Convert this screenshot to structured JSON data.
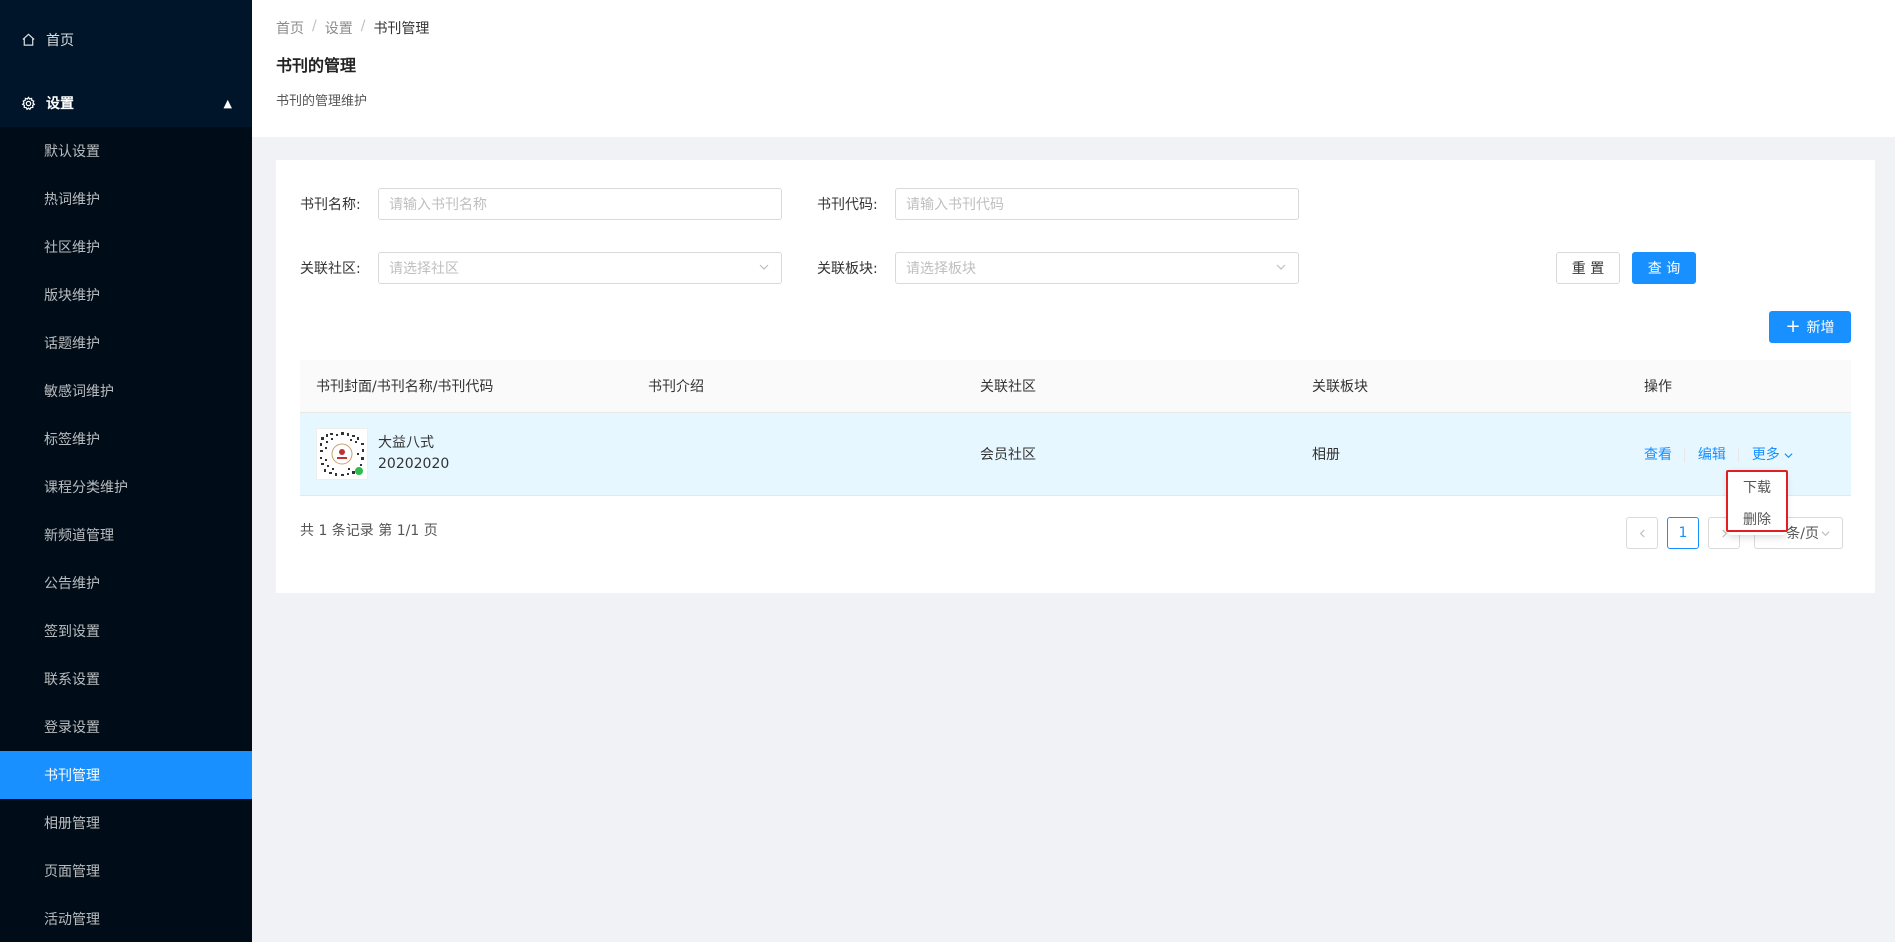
{
  "sidebar": {
    "home_label": "首页",
    "group_label": "设置",
    "items": [
      {
        "label": "默认设置"
      },
      {
        "label": "热词维护"
      },
      {
        "label": "社区维护"
      },
      {
        "label": "版块维护"
      },
      {
        "label": "话题维护"
      },
      {
        "label": "敏感词维护"
      },
      {
        "label": "标签维护"
      },
      {
        "label": "课程分类维护"
      },
      {
        "label": "新频道管理"
      },
      {
        "label": "公告维护"
      },
      {
        "label": "签到设置"
      },
      {
        "label": "联系设置"
      },
      {
        "label": "登录设置"
      },
      {
        "label": "书刊管理"
      },
      {
        "label": "相册管理"
      },
      {
        "label": "页面管理"
      },
      {
        "label": "活动管理"
      }
    ],
    "active_item": "书刊管理"
  },
  "header": {
    "breadcrumb": [
      "首页",
      "设置",
      "书刊管理"
    ],
    "title": "书刊的管理",
    "description": "书刊的管理维护"
  },
  "filters": {
    "name_label": "书刊名称:",
    "name_placeholder": "请输入书刊名称",
    "code_label": "书刊代码:",
    "code_placeholder": "请输入书刊代码",
    "community_label": "关联社区:",
    "community_placeholder": "请选择社区",
    "section_label": "关联板块:",
    "section_placeholder": "请选择板块",
    "reset_label": "重 置",
    "query_label": "查 询"
  },
  "toolbar": {
    "add_label": "新增"
  },
  "table": {
    "columns": [
      "书刊封面/书刊名称/书刊代码",
      "书刊介绍",
      "关联社区",
      "关联板块",
      "操作"
    ],
    "rows": [
      {
        "name": "大益八式",
        "code": "20202020",
        "intro": "",
        "community": "会员社区",
        "section": "相册"
      }
    ],
    "actions": {
      "view": "查看",
      "edit": "编辑",
      "more": "更多"
    }
  },
  "pagination": {
    "summary": "共 1 条记录 第 1/1 页",
    "current_page": "1",
    "page_size_label": "条/页"
  },
  "more_menu": {
    "items": [
      "下载",
      "删除"
    ]
  },
  "colors": {
    "primary": "#1890ff",
    "sidebar": "#001529",
    "highlight": "#e02020"
  }
}
